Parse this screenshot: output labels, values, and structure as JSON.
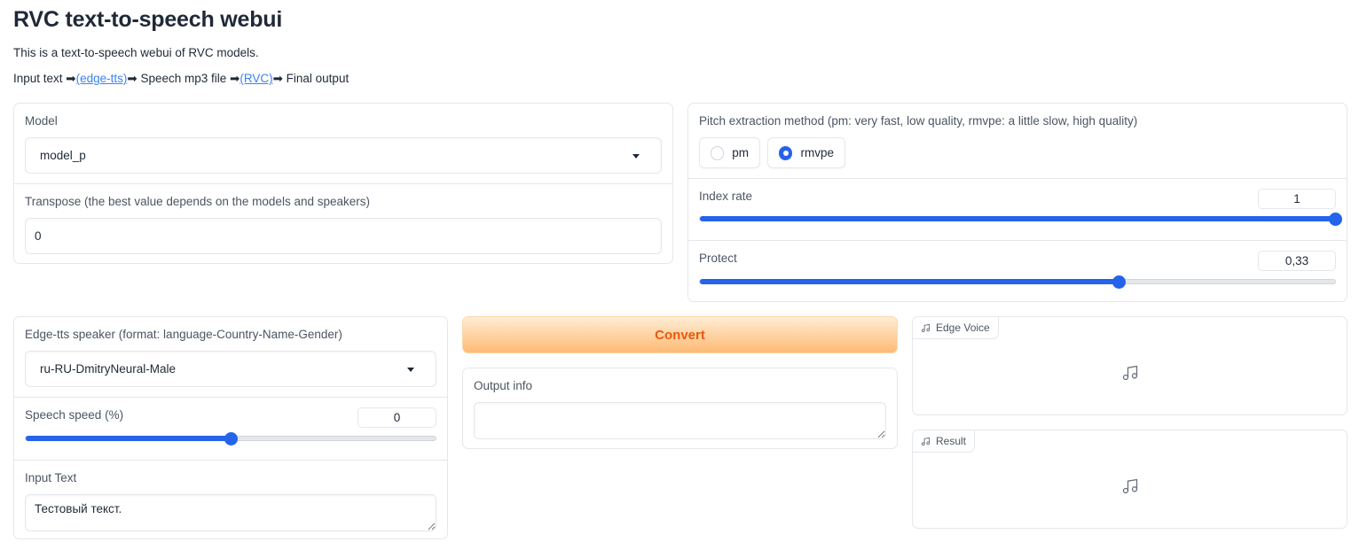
{
  "header": {
    "title": "RVC text-to-speech webui",
    "description": "This is a text-to-speech webui of RVC models.",
    "flow": {
      "input_text": "Input text ",
      "arrow1": "➡",
      "link1": "(edge-tts)",
      "step2": "➡ Speech mp3 file ",
      "arrow2": "➡",
      "link2": "(RVC)",
      "step3": "➡ Final output"
    }
  },
  "model_panel": {
    "model_label": "Model",
    "model_value": "model_p",
    "transpose_label": "Transpose (the best value depends on the models and speakers)",
    "transpose_value": "0"
  },
  "pitch_panel": {
    "label": "Pitch extraction method (pm: very fast, low quality, rmvpe: a little slow, high quality)",
    "options": [
      {
        "label": "pm",
        "checked": false
      },
      {
        "label": "rmvpe",
        "checked": true
      }
    ],
    "index_rate_label": "Index rate",
    "index_rate_value": "1",
    "index_rate_fraction": 1.0,
    "protect_label": "Protect",
    "protect_value": "0,33",
    "protect_fraction": 0.66
  },
  "tts_panel": {
    "speaker_label": "Edge-tts speaker (format: language-Country-Name-Gender)",
    "speaker_value": "ru-RU-DmitryNeural-Male",
    "speed_label": "Speech speed (%)",
    "speed_value": "0",
    "speed_fraction": 0.5,
    "input_text_label": "Input Text",
    "input_text_value": "Тестовый текст."
  },
  "convert_button": "Convert",
  "output": {
    "label": "Output info",
    "value": ""
  },
  "audio": {
    "edge_voice_label": "Edge Voice",
    "result_label": "Result"
  },
  "colors": {
    "accent": "#2563eb",
    "convert_text": "#ea580c",
    "link": "#3b82f6"
  }
}
